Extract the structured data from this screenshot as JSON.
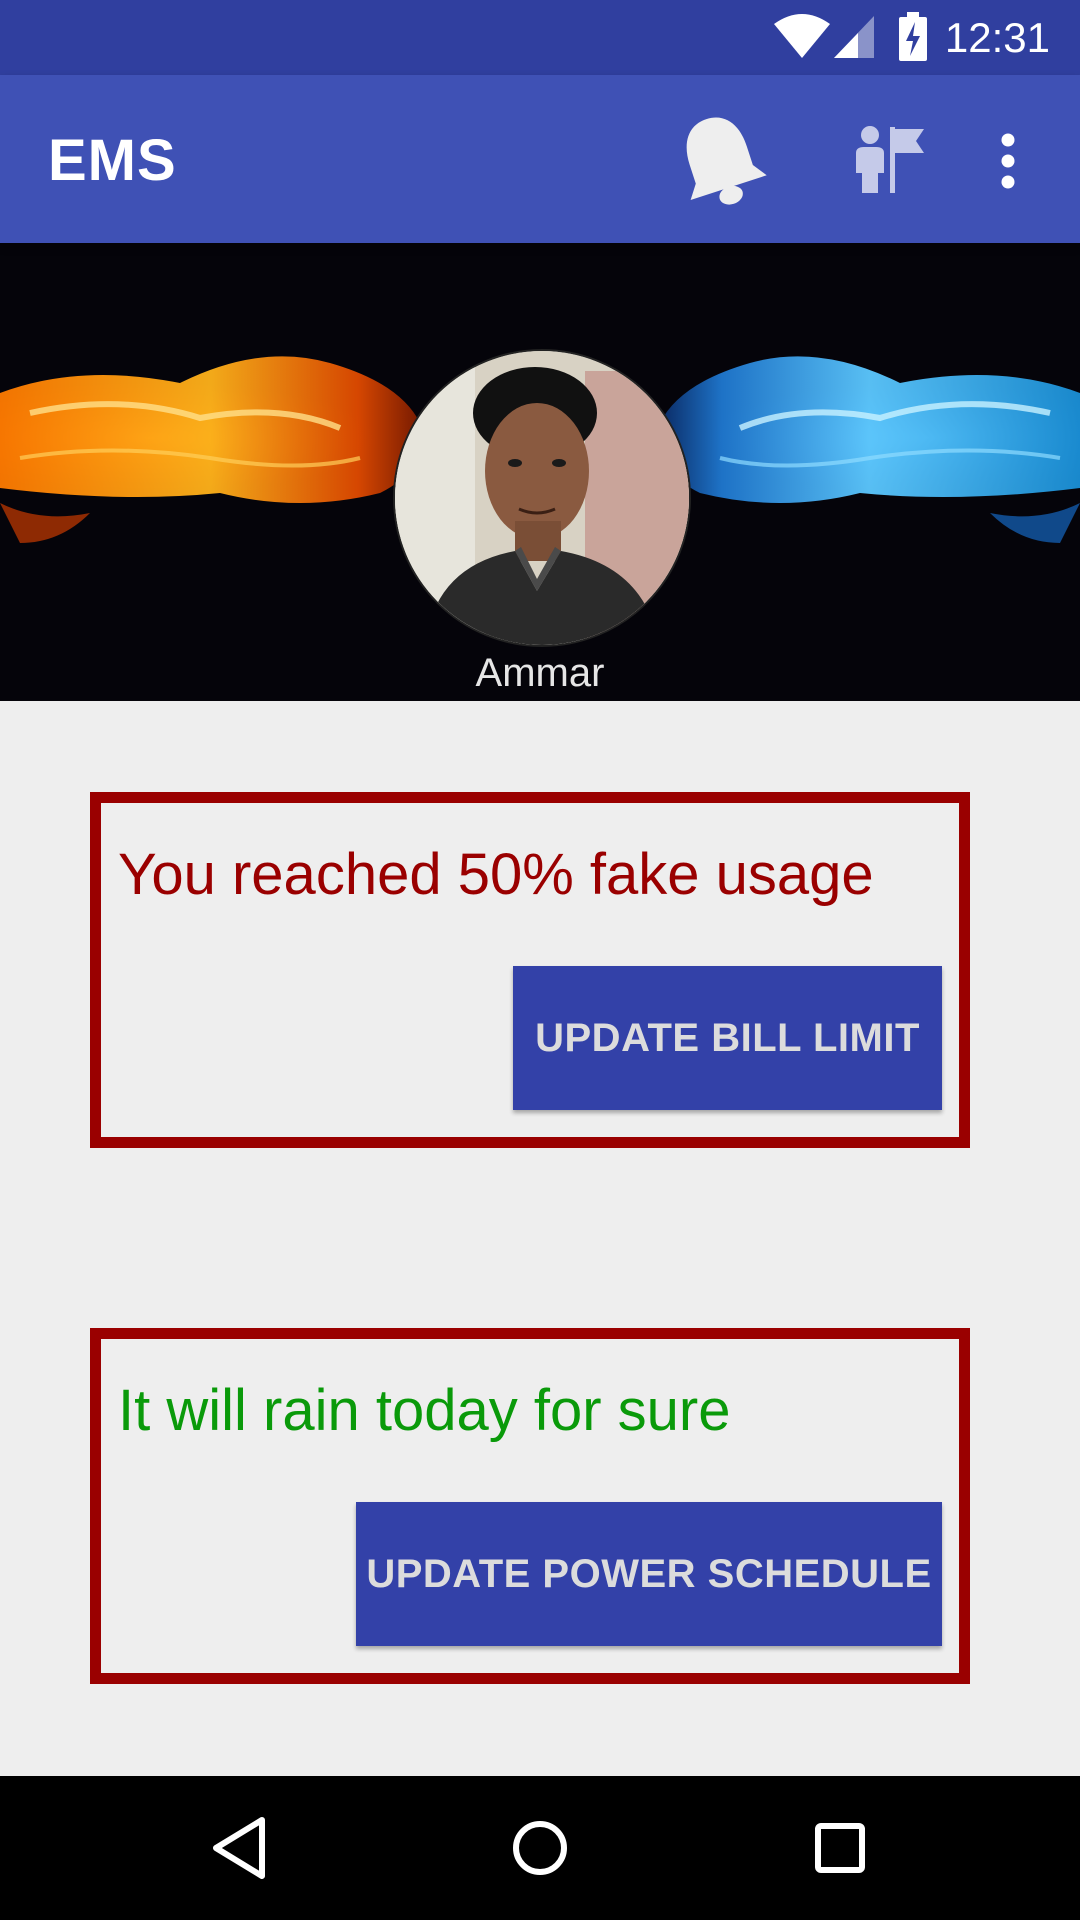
{
  "status_bar": {
    "time": "12:31",
    "icons": [
      "wifi-icon",
      "cell-signal-icon",
      "battery-charging-icon"
    ]
  },
  "app_bar": {
    "title": "EMS",
    "actions": [
      "bell-icon",
      "person-flag-icon",
      "more-vert-icon"
    ]
  },
  "profile": {
    "name": "Ammar"
  },
  "cards": [
    {
      "message": "You reached 50% fake usage",
      "message_color": "#9a0000",
      "button_label": "UPDATE BILL LIMIT"
    },
    {
      "message": "It will rain today for sure",
      "message_color": "#0a9a0a",
      "button_label": "UPDATE POWER SCHEDULE"
    }
  ],
  "nav_bar": {
    "buttons": [
      "back-icon",
      "home-icon",
      "recents-icon"
    ]
  },
  "colors": {
    "status_bar": "#303f9f",
    "app_bar": "#3f51b5",
    "button": "#3341a8",
    "card_border": "#9a0000"
  }
}
